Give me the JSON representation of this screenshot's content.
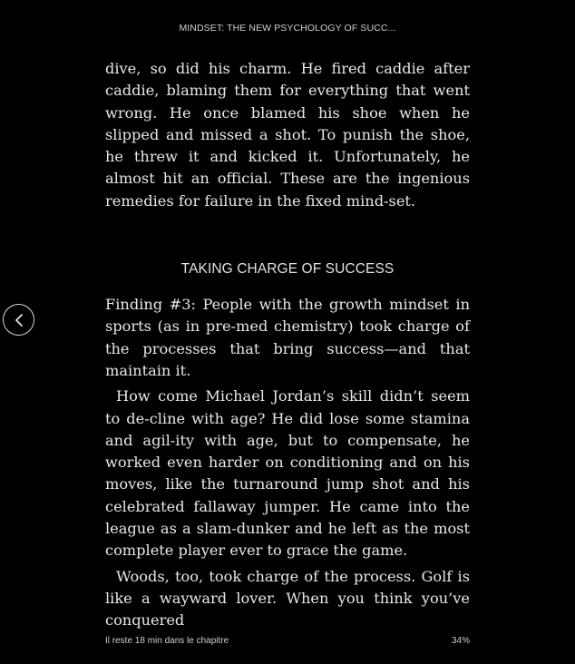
{
  "header": {
    "book_title": "MINDSET: THE NEW PSYCHOLOGY OF SUCC..."
  },
  "content": {
    "paragraph_1": "dive, so did his charm. He fired caddie after caddie, blaming them for everything that went wrong. He once blamed his shoe when he slipped and missed a shot. To punish the shoe, he threw it and kicked it. Unfortunately, he almost hit an official. These are the ingenious remedies for failure in the fixed mind-set.",
    "section_heading": "TAKING CHARGE OF SUCCESS",
    "paragraph_2": "Finding #3: People with the growth mindset in sports (as in pre-med chemistry) took charge of the processes that bring success—and that maintain it.",
    "paragraph_3": "How come Michael Jordan’s skill didn’t seem to de-cline with age? He did lose some stamina and agil-ity with age, but to compensate, he worked even harder on conditioning and on his moves, like the turnaround jump shot and his celebrated fallaway jumper. He came into the league as a slam-dunker and he left as the most complete player ever to grace the game.",
    "paragraph_4": "Woods, too, took charge of the process. Golf is like a wayward lover. When you think you’ve conquered"
  },
  "navigation": {
    "back_icon": "chevron-left-icon"
  },
  "footer": {
    "time_left": "Il reste 18 min dans le chapitre",
    "progress": "34%"
  },
  "colors": {
    "background": "#000000",
    "text": "#e8e8e8"
  }
}
